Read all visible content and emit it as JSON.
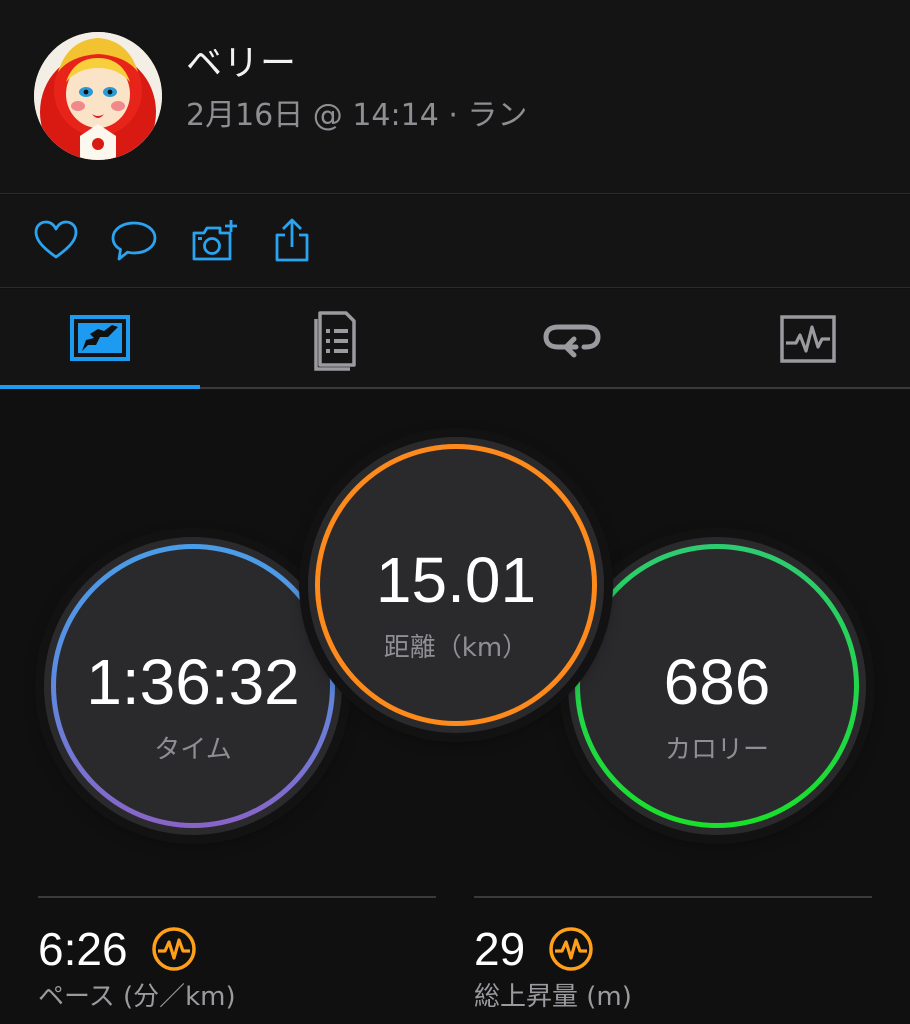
{
  "user": {
    "name": "ベリー",
    "meta": "2月16日 @ 14:14 · ラン"
  },
  "actions": [
    {
      "name": "like",
      "icon": "heart-icon"
    },
    {
      "name": "comment",
      "icon": "speech-bubble-icon"
    },
    {
      "name": "add-photo",
      "icon": "camera-plus-icon"
    },
    {
      "name": "share",
      "icon": "share-icon"
    }
  ],
  "tabs": [
    {
      "name": "map-stats",
      "icon": "stats-map-icon",
      "active": true
    },
    {
      "name": "details",
      "icon": "document-list-icon",
      "active": false
    },
    {
      "name": "laps",
      "icon": "loop-icon",
      "active": false
    },
    {
      "name": "charts",
      "icon": "heart-rate-chart-icon",
      "active": false
    }
  ],
  "stats": {
    "time": {
      "value": "1:36:32",
      "label": "タイム"
    },
    "distance": {
      "value": "15.01",
      "label": "距離（km）"
    },
    "calories": {
      "value": "686",
      "label": "カロリー"
    }
  },
  "metrics": {
    "pace": {
      "value": "6:26",
      "label": "ペース (分／km)",
      "icon": "performance-pulse-icon"
    },
    "elevation": {
      "value": "29",
      "label": "総上昇量 (m)",
      "icon": "performance-pulse-icon"
    }
  },
  "colors": {
    "accent": "#1d9bf0",
    "time_ring_top": "#4a9de8",
    "time_ring_bottom": "#8a63c8",
    "distance_ring": "#ff8a1c",
    "calories_ring_top": "#2ecc71",
    "calories_ring_bottom": "#19e02a",
    "metric_icon": "#ff9f1a"
  }
}
